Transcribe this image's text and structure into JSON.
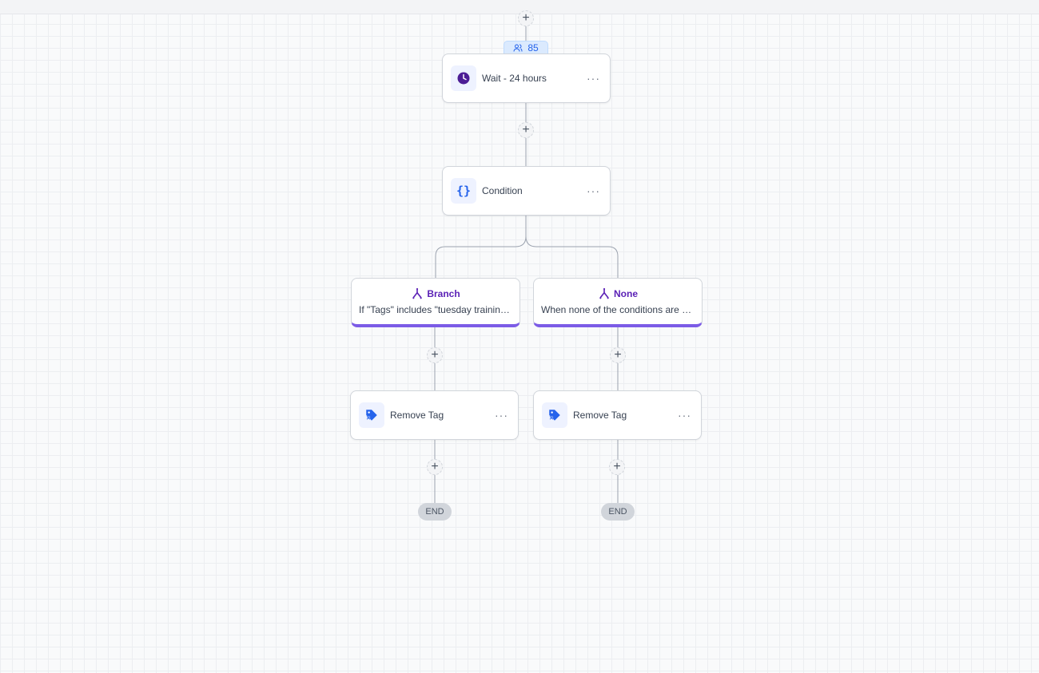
{
  "workflow": {
    "count_badge": "85",
    "wait_node": {
      "label": "Wait - 24 hours",
      "icon": "clock-icon",
      "menu": "···"
    },
    "condition_node": {
      "label": "Condition",
      "icon": "braces-icon",
      "menu": "···"
    },
    "branches": [
      {
        "title": "Branch",
        "description": "If \"Tags\" includes \"tuesday training ...",
        "icon": "branch-icon"
      },
      {
        "title": "None",
        "description": "When none of the conditions are met",
        "icon": "branch-icon"
      }
    ],
    "actions": [
      {
        "label": "Remove Tag",
        "icon": "tag-remove-icon",
        "menu": "···"
      },
      {
        "label": "Remove Tag",
        "icon": "tag-remove-icon",
        "menu": "···"
      }
    ],
    "end_label": "END",
    "add_step_symbol": "+"
  },
  "colors": {
    "accent_purple": "#5b21b6",
    "branch_border": "#7c5ce6",
    "badge_blue": "#2563eb",
    "tag_blue": "#2563eb"
  }
}
